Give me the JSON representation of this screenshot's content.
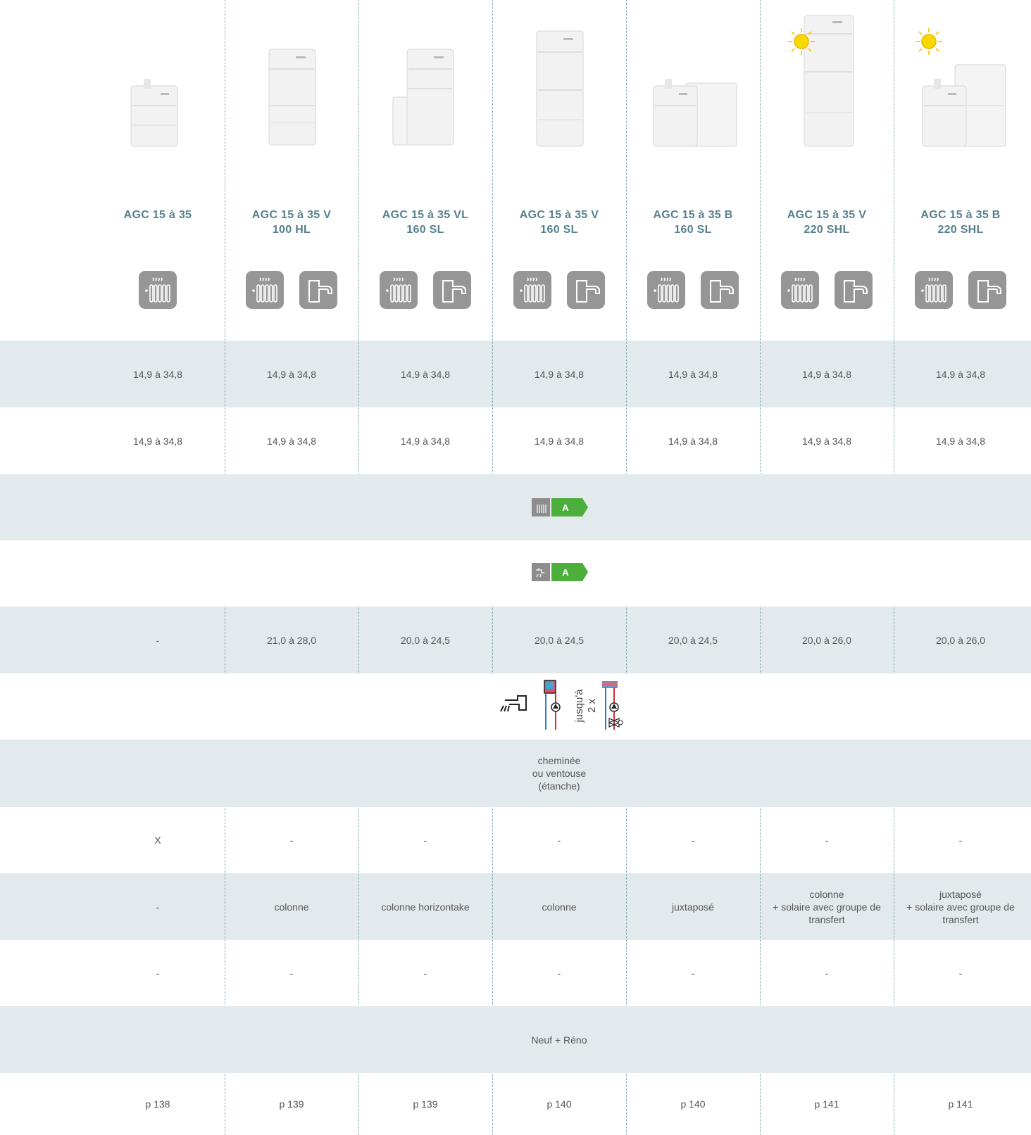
{
  "columns": [
    {
      "title": "AGC 15 à 35",
      "icons": [
        "radiator-icon"
      ],
      "solar": false,
      "product": "compact"
    },
    {
      "title": "AGC 15 à 35 V\n100 HL",
      "icons": [
        "radiator-icon",
        "tap-icon"
      ],
      "solar": false,
      "product": "column-short"
    },
    {
      "title": "AGC 15 à 35 VL\n160 SL",
      "icons": [
        "radiator-icon",
        "tap-icon"
      ],
      "solar": false,
      "product": "column-side"
    },
    {
      "title": "AGC 15 à 35 V\n160 SL",
      "icons": [
        "radiator-icon",
        "tap-icon"
      ],
      "solar": false,
      "product": "column-tall"
    },
    {
      "title": "AGC 15 à 35 B\n160 SL",
      "icons": [
        "radiator-icon",
        "tap-icon"
      ],
      "solar": false,
      "product": "juxtaposed"
    },
    {
      "title": "AGC 15 à 35 V\n220 SHL",
      "icons": [
        "radiator-icon",
        "tap-icon"
      ],
      "solar": true,
      "product": "column-tallest"
    },
    {
      "title": "AGC 15 à 35 B\n220 SHL",
      "icons": [
        "radiator-icon",
        "tap-icon"
      ],
      "solar": true,
      "product": "juxtaposed-tall"
    }
  ],
  "rows": {
    "power_heating": [
      "14,9 à 34,8",
      "14,9 à 34,8",
      "14,9 à 34,8",
      "14,9 à 34,8",
      "14,9 à 34,8",
      "14,9 à 34,8",
      "14,9 à 34,8"
    ],
    "power_dhw": [
      "14,9 à 34,8",
      "14,9 à 34,8",
      "14,9 à 34,8",
      "14,9 à 34,8",
      "14,9 à 34,8",
      "14,9 à 34,8",
      "14,9 à 34,8"
    ],
    "energy_heating_class": "A",
    "energy_dhw_class": "A",
    "dhw_flow": [
      "-",
      "21,0 à 28,0",
      "20,0 à 24,5",
      "20,0 à 24,5",
      "20,0 à 24,5",
      "20,0 à 26,0",
      "20,0 à 26,0"
    ],
    "circuits_text": "jusqu'à\n2 x",
    "evacuation": "cheminée\nou ventouse\n(étanche)",
    "row_x": [
      "X",
      "-",
      "-",
      "-",
      "-",
      "-",
      "-"
    ],
    "layout": [
      "-",
      "colonne",
      "colonne horizontake",
      "colonne",
      "juxtaposé",
      "colonne\n+ solaire avec groupe de\ntransfert",
      "juxtaposé\n+ solaire avec groupe de\ntransfert"
    ],
    "row_dash": [
      "-",
      "-",
      "-",
      "-",
      "-",
      "-",
      "-"
    ],
    "usage": "Neuf + Réno",
    "pages": [
      "p 138",
      "p 139",
      "p 139",
      "p 140",
      "p 140",
      "p 141",
      "p 141"
    ]
  },
  "colors": {
    "title": "#56808e",
    "shade": "#e3eaed",
    "energy_green": "#4caf3c",
    "icon_gray": "#969696",
    "sun": "#f5d400"
  }
}
